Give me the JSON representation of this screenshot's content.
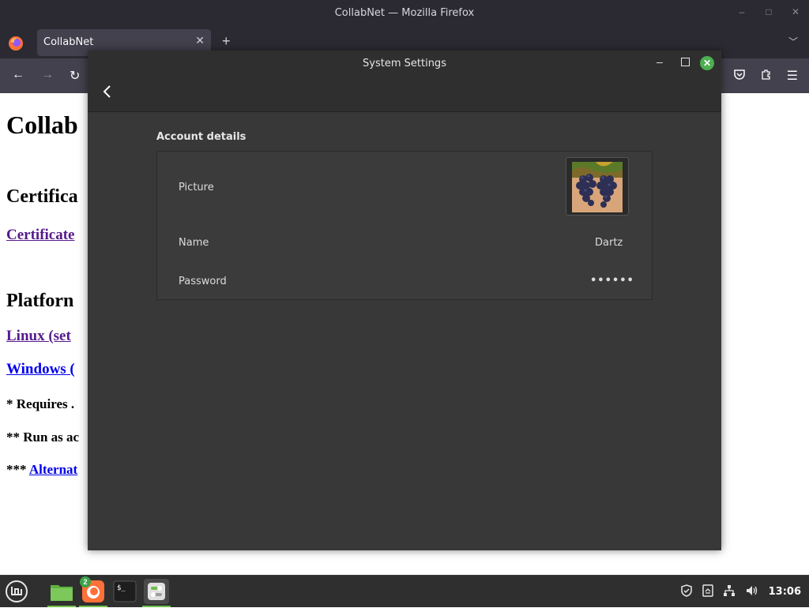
{
  "firefox": {
    "window_title": "CollabNet — Mozilla Firefox",
    "tab_label": "CollabNet",
    "page": {
      "h1": "Collab",
      "certificates_heading": "Certifica",
      "certificates_link": "Certificate",
      "platforms_heading": "Platforn",
      "linux_link": "Linux (set",
      "windows_link": "Windows (",
      "note1": "* Requires .",
      "note2": "** Run as ac",
      "note3_prefix": "*** ",
      "note3_link": "Alternat"
    }
  },
  "settings": {
    "window_title": "System Settings",
    "section_title": "Account details",
    "rows": {
      "picture_label": "Picture",
      "name_label": "Name",
      "name_value": "Dartz",
      "password_label": "Password",
      "password_value": "••••••"
    }
  },
  "taskbar": {
    "files_badge": "2",
    "clock": "13:06"
  },
  "colors": {
    "accent_green": "#4caf50",
    "firefox_chrome": "#2b2a33",
    "dialog_bg": "#383838"
  }
}
